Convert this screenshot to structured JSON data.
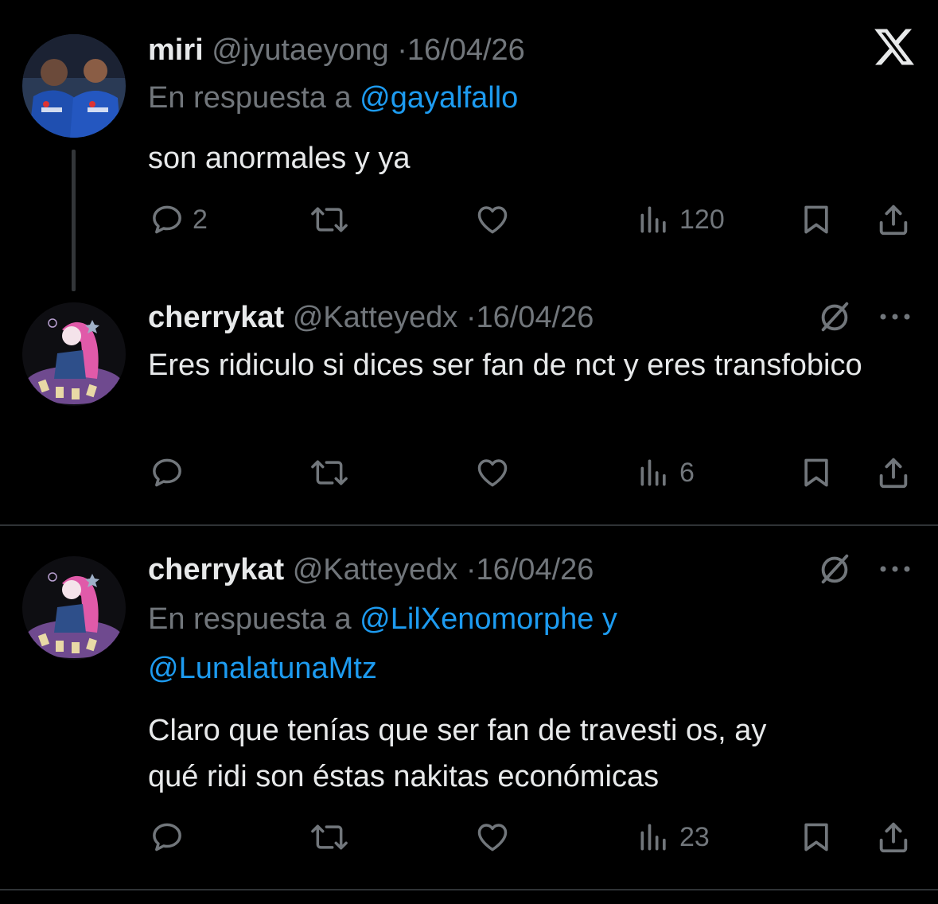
{
  "tweets": [
    {
      "name": "miri",
      "handle": "@jyutaeyong",
      "separator": "·",
      "date": "16/04/26",
      "reply_prefix": "En respuesta a",
      "reply_mentions": "@gayalfallo",
      "text": "son anormales y ya",
      "replies": "2",
      "views": "120",
      "avatar": "photo-two-people-blue-jerseys"
    },
    {
      "name": "cherrykat",
      "handle": "@Katteyedx",
      "separator": "·",
      "date": "16/04/26",
      "text": "Eres ridiculo si dices ser fan de nct y eres transfobico",
      "replies": "",
      "views": "6",
      "avatar": "illustration-pink-hair-girl-tarot"
    },
    {
      "name": "cherrykat",
      "handle": "@Katteyedx",
      "separator": "·",
      "date": "16/04/26",
      "reply_prefix": "En respuesta a",
      "reply_mentions_line1": "@LilXenomorphe y",
      "reply_mentions_line2": "@LunalatunaMtz",
      "text_line1": "Claro que tenías que ser fan de travesti os, ay",
      "text_line2": "qué ridi son éstas nakitas económicas",
      "replies": "",
      "views": "23",
      "avatar": "illustration-pink-hair-girl-tarot"
    }
  ],
  "icons": {
    "close": "x-logo-icon",
    "reply": "comment-icon",
    "retweet": "repost-icon",
    "like": "heart-icon",
    "views": "views-chart-icon",
    "bookmark": "bookmark-icon",
    "share": "share-icon",
    "grok": "grok-icon",
    "more": "more-icon"
  },
  "colors": {
    "background": "#000000",
    "text": "#e7e9ea",
    "muted": "#71767b",
    "link": "#1d9bf0",
    "divider": "#2f3336"
  }
}
